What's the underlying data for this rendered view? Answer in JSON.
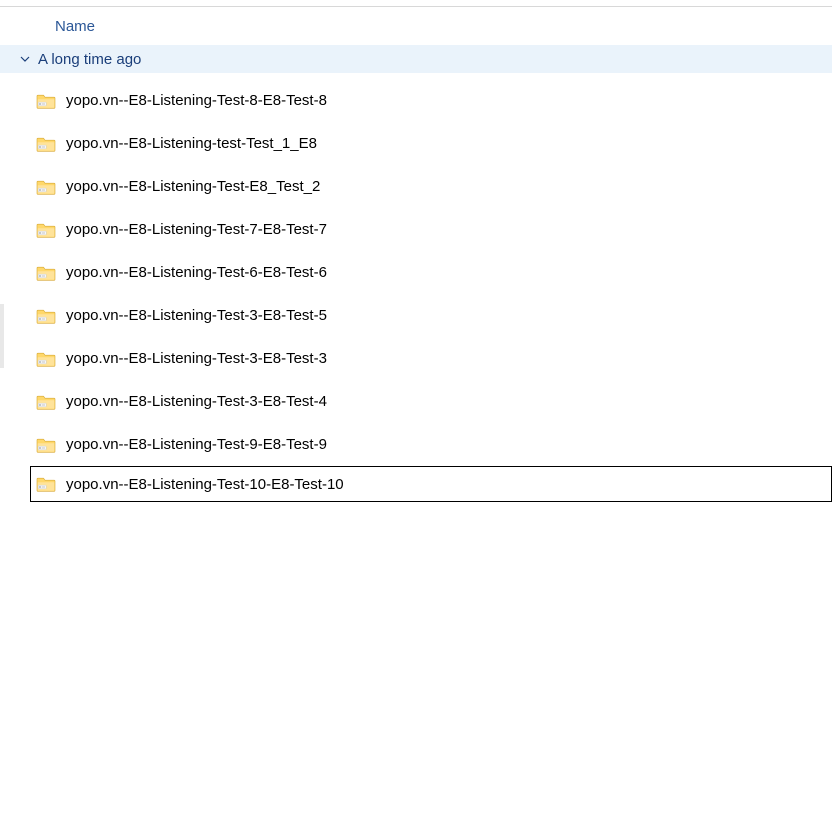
{
  "header": {
    "column_name": "Name"
  },
  "group": {
    "label": "A long time ago",
    "expanded": true
  },
  "files": [
    {
      "name": "yopo.vn--E8-Listening-Test-8-E8-Test-8",
      "selected": false
    },
    {
      "name": "yopo.vn--E8-Listening-test-Test_1_E8",
      "selected": false
    },
    {
      "name": "yopo.vn--E8-Listening-Test-E8_Test_2",
      "selected": false
    },
    {
      "name": "yopo.vn--E8-Listening-Test-7-E8-Test-7",
      "selected": false
    },
    {
      "name": "yopo.vn--E8-Listening-Test-6-E8-Test-6",
      "selected": false
    },
    {
      "name": "yopo.vn--E8-Listening-Test-3-E8-Test-5",
      "selected": false
    },
    {
      "name": "yopo.vn--E8-Listening-Test-3-E8-Test-3",
      "selected": false
    },
    {
      "name": "yopo.vn--E8-Listening-Test-3-E8-Test-4",
      "selected": false
    },
    {
      "name": "yopo.vn--E8-Listening-Test-9-E8-Test-9",
      "selected": false
    },
    {
      "name": "yopo.vn--E8-Listening-Test-10-E8-Test-10",
      "selected": true
    }
  ]
}
